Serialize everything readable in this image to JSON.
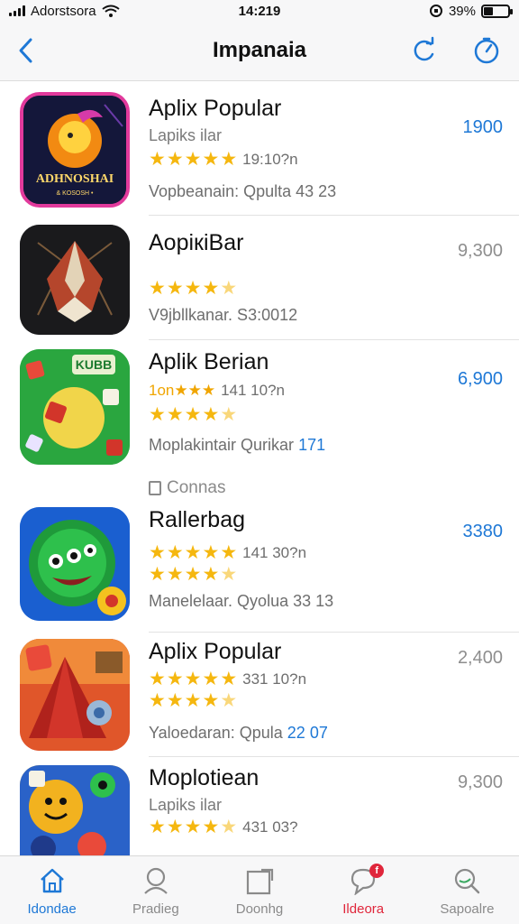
{
  "status_bar": {
    "carrier": "Adorstsora",
    "time": "14:219",
    "battery": "39%",
    "battery_level": 0.39
  },
  "nav": {
    "title": "Impanaia"
  },
  "apps": [
    {
      "name": "Aplix Popular",
      "subtitle": "Lapiks ilar",
      "price": "1900",
      "price_color": "#1e78d6",
      "rating_prefix": "",
      "stars": 5,
      "rating_text": "19:10?n",
      "second_stars": 0,
      "meta_text": "Vopbeanain: Qpulta 43 23",
      "meta_accent": "",
      "icon_text": "ADHNOSHAI",
      "icon_subtext": "& KOSOSH •"
    },
    {
      "name": "AopiкiBar",
      "subtitle": "",
      "price": "9,300",
      "price_color": "#8e8e8e",
      "rating_prefix": "",
      "stars": 4.5,
      "rating_text": "",
      "second_stars": 0,
      "meta_text": "V9jbllkanar. S3:0012",
      "meta_accent": ""
    },
    {
      "name": "Aplik Berian",
      "subtitle": "",
      "price": "6,900",
      "price_color": "#1e78d6",
      "rating_prefix": "1on★★★",
      "stars": 0,
      "rating_text": "141 10?n",
      "second_stars": 4.5,
      "meta_text": "Moplakintair Qurikar",
      "meta_accent": "171",
      "icon_text": "KUBB"
    },
    {
      "name": "Rallerbag",
      "subtitle": "",
      "price": "3380",
      "price_color": "#1e78d6",
      "rating_prefix": "",
      "stars": 5,
      "rating_text": "141 30?n",
      "second_stars": 4.5,
      "meta_text": "Manelelaar. Qyolua 33 13",
      "meta_accent": ""
    },
    {
      "name": "Aplix Popular",
      "subtitle": "",
      "price": "2,400",
      "price_color": "#8e8e8e",
      "rating_prefix": "",
      "stars": 5,
      "rating_text": "331 10?n",
      "second_stars": 4.5,
      "meta_text": "Yaloedaran: Qpula",
      "meta_accent": "22 07"
    },
    {
      "name": "Moplotiean",
      "subtitle": "Lapiks ilar",
      "price": "9,300",
      "price_color": "#8e8e8e",
      "rating_prefix": "",
      "stars": 4.5,
      "rating_text": "431 03?",
      "second_stars": 0,
      "meta_text": "",
      "meta_accent": ""
    }
  ],
  "section_label": "Connas",
  "tabs": [
    {
      "label": "Idondae",
      "icon": "home-icon",
      "color": "#1e78d6"
    },
    {
      "label": "Pradieg",
      "icon": "person-icon",
      "color": "#8a8a8a"
    },
    {
      "label": "Doonhg",
      "icon": "compose-icon",
      "color": "#8a8a8a"
    },
    {
      "label": "Ildeora",
      "icon": "chat-icon",
      "color": "#e0263b",
      "badge": "f"
    },
    {
      "label": "Sapoalre",
      "icon": "search-icon",
      "color": "#8a8a8a"
    }
  ],
  "colors": {
    "accent": "#1e78d6",
    "star": "#f5b70f",
    "badge": "#e0263b"
  }
}
